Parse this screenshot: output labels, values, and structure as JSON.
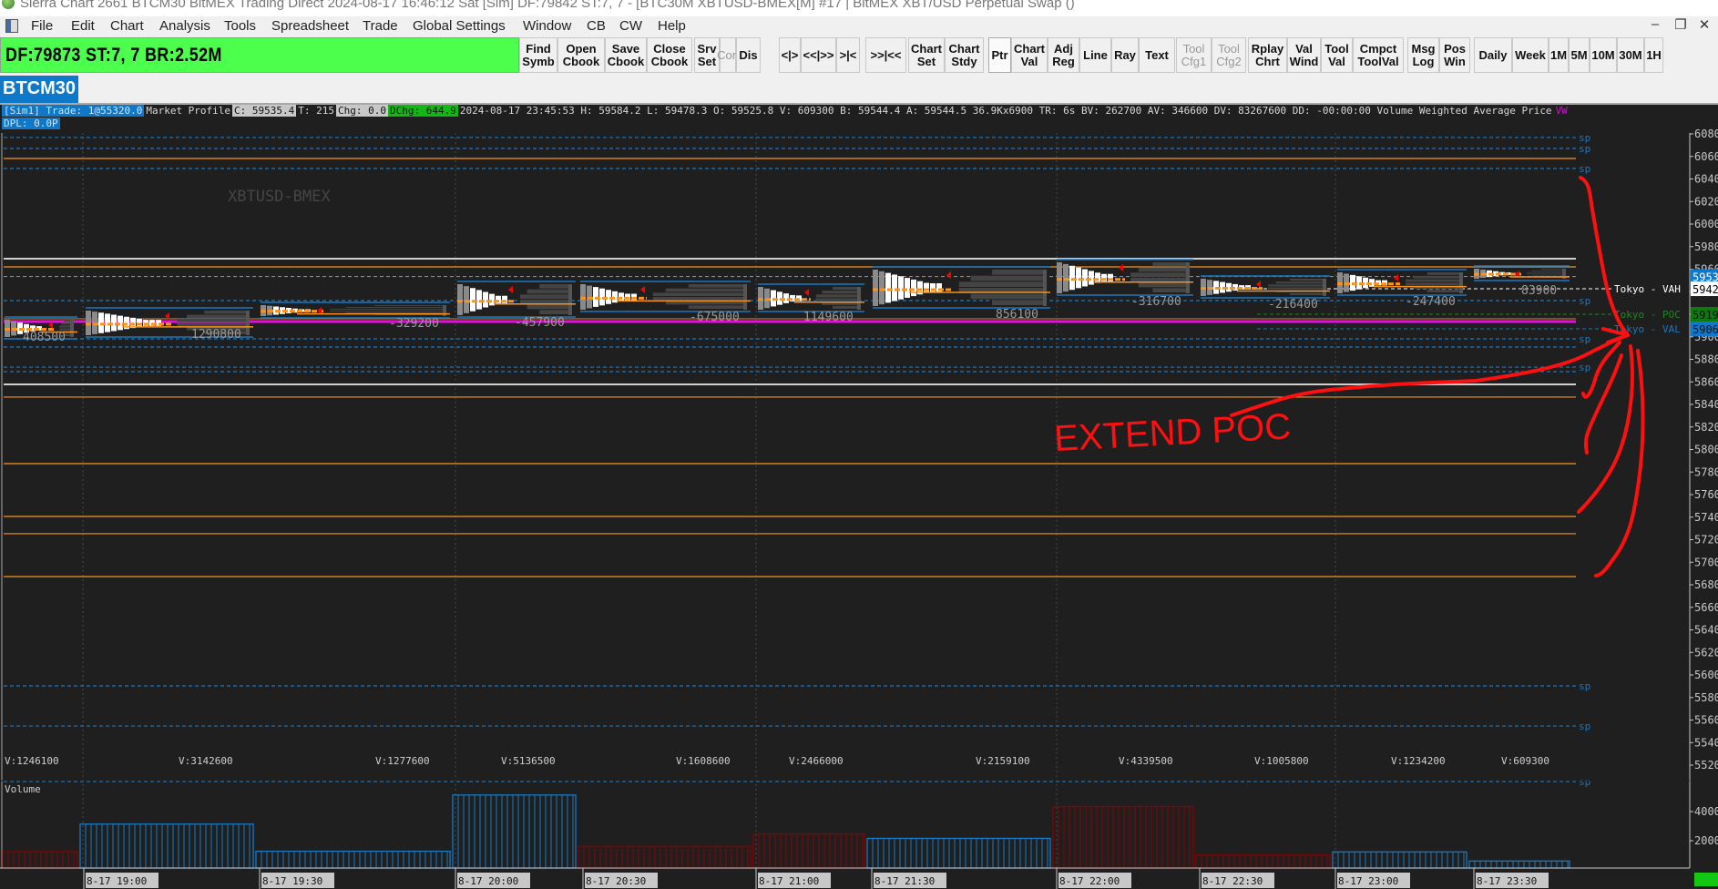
{
  "window": {
    "title": "Sierra Chart 2661 BTCM30 BitMEX Trading Direct 2024-08-17  16:46:12 Sat [Sim] DF:79842  ST:7, 7 - [BTC30M XBTUSD-BMEX[M] #17 | BitMEX XBT/USD Perpetual Swap ()",
    "controls": {
      "minimize": "–",
      "restore": "❐",
      "close": "✕"
    }
  },
  "menu": [
    "File",
    "Edit",
    "Chart",
    "Analysis",
    "Tools",
    "Spreadsheet",
    "Trade",
    "Global Settings",
    "Window",
    "CB",
    "CW",
    "Help"
  ],
  "status_box": {
    "text": "DF:79873  ST:7, 7  BR:2.52M",
    "color": "#4cff4c"
  },
  "toolbar": [
    {
      "label": "Find\nSymb"
    },
    {
      "label": "Open\nCbook"
    },
    {
      "label": "Save\nCbook"
    },
    {
      "label": "Close\nCbook"
    },
    {
      "label": "Srv\nSet"
    },
    {
      "label": "Con",
      "disabled": true
    },
    {
      "label": "Dis"
    },
    {
      "label": "<|>"
    },
    {
      "label": "<<|>>"
    },
    {
      "label": ">|<"
    },
    {
      "label": ">>|<<"
    },
    {
      "label": "Chart\nSet"
    },
    {
      "label": "Chart\nStdy"
    },
    {
      "label": "Ptr",
      "selected": true
    },
    {
      "label": "Chart\nVal"
    },
    {
      "label": "Adj\nReg"
    },
    {
      "label": "Line"
    },
    {
      "label": "Ray"
    },
    {
      "label": "Text"
    },
    {
      "label": "Tool\nCfg1",
      "disabled": true
    },
    {
      "label": "Tool\nCfg2",
      "disabled": true
    },
    {
      "label": "Rplay\nChrt"
    },
    {
      "label": "Val\nWind"
    },
    {
      "label": "Tool\nVal"
    },
    {
      "label": "Cmpct\nToolVal"
    },
    {
      "label": "Msg\nLog"
    },
    {
      "label": "Pos\nWin"
    },
    {
      "label": "Daily"
    },
    {
      "label": "Week"
    },
    {
      "label": "1M"
    },
    {
      "label": "5M"
    },
    {
      "label": "10M"
    },
    {
      "label": "30M"
    },
    {
      "label": "1H"
    }
  ],
  "chart_tab": {
    "label": "BTCM30",
    "color": "#0f78c8"
  },
  "info_bar": {
    "sim_trade": "[Sim1]  Trade: 1@55320.0",
    "study": "Market Profile",
    "close": "C: 59535.4",
    "ticks": "T: 215",
    "chg": "Chg: 0.0",
    "dchg": "DChg: 644.9",
    "details": "2024-08-17 23:45:53 H: 59584.2 L: 59478.3 O: 59525.8 V: 609300 B: 59544.4 A: 59544.5 36.9Kx6900 TR: 6s BV: 262700 AV: 346600 DV: 83267600 DD: -00:00:00 Volume Weighted Average Price",
    "vwap_tag": "VW",
    "dpl": "DPL: 0.0P"
  },
  "symbol_watermark": "XBTUSD-BMEX",
  "chart_data": {
    "type": "market-profile",
    "price_axis": {
      "ticks": [
        60800,
        60600,
        60400,
        60200,
        60000,
        59800,
        59600,
        59400,
        59200,
        59000,
        58800,
        58600,
        58400,
        58200,
        58000,
        57800,
        57600,
        57400,
        57200,
        57000,
        56800,
        56600,
        56400,
        56200,
        56000,
        55800,
        55600,
        55400,
        55200
      ]
    },
    "price_labels": [
      {
        "text": "5953",
        "price": 59535.4,
        "bg": "#0f78c8",
        "fg": "#ffffff"
      },
      {
        "text": "5942",
        "price": 59426,
        "bg": "#ffffff",
        "fg": "#000000"
      },
      {
        "text": "5919",
        "price": 59200,
        "bg": "#0e7a0e",
        "fg": "#111111"
      },
      {
        "text": "5906",
        "price": 59071,
        "bg": "#0f78c8",
        "fg": "#111111"
      }
    ],
    "session_levels": [
      {
        "text": "Tokyo  -  VAH",
        "price": 59426,
        "color": "#ffffff"
      },
      {
        "text": "Tokyo  -  POC",
        "price": 59200,
        "color": "#1a8a1a"
      },
      {
        "text": "Tokyo  -  VAL",
        "price": 59071,
        "color": "#1a78c0"
      }
    ],
    "levels": [
      {
        "price": 60768,
        "style": "dashed",
        "color": "#1a78c0",
        "tag": "sp"
      },
      {
        "price": 60671,
        "style": "dashed",
        "color": "#1a78c0",
        "tag": "sp"
      },
      {
        "price": 60582,
        "style": "solid",
        "color": "#f7931e"
      },
      {
        "price": 60493,
        "style": "dashed",
        "color": "#1a78c0",
        "tag": "sp"
      },
      {
        "price": 59693,
        "style": "solid",
        "color": "#d0d0d0"
      },
      {
        "price": 59620,
        "style": "solid",
        "color": "#f7931e"
      },
      {
        "price": 59535,
        "style": "dashed",
        "color": "#8a8a8a"
      },
      {
        "price": 59321,
        "style": "dashed",
        "color": "#1a78c0",
        "tag": "sp"
      },
      {
        "price": 59160,
        "style": "solid",
        "color": "#c87020"
      },
      {
        "price": 59135,
        "style": "solid",
        "color": "#e010e0"
      },
      {
        "price": 58982,
        "style": "dashed",
        "color": "#1a78c0",
        "tag": "sp"
      },
      {
        "price": 58909,
        "style": "dashed",
        "color": "#1a78c0"
      },
      {
        "price": 58731,
        "style": "dashed",
        "color": "#1a78c0",
        "tag": "sp"
      },
      {
        "price": 58691,
        "style": "dashed",
        "color": "#1a78c0"
      },
      {
        "price": 58578,
        "style": "solid",
        "color": "#d0d0d0"
      },
      {
        "price": 58465,
        "style": "solid",
        "color": "#f7931e"
      },
      {
        "price": 57875,
        "style": "solid",
        "color": "#f7931e"
      },
      {
        "price": 57406,
        "style": "solid",
        "color": "#f7931e"
      },
      {
        "price": 57253,
        "style": "solid",
        "color": "#f7931e"
      },
      {
        "price": 56873,
        "style": "solid",
        "color": "#f7931e"
      },
      {
        "price": 55903,
        "style": "dashed",
        "color": "#1a78c0",
        "tag": "sp"
      },
      {
        "price": 55547,
        "style": "dashed",
        "color": "#1a78c0",
        "tag": "sp"
      },
      {
        "price": 55054,
        "style": "dashed",
        "color": "#1a78c0",
        "tag": "sp"
      }
    ],
    "delta_labels": [
      "408500",
      "1290800",
      "-329200",
      "-457900",
      "-675000",
      "1149600",
      "856100",
      "-316700",
      "-216400",
      "-247400",
      "83900"
    ],
    "period_volumes": [
      "V:1246100",
      "V:3142600",
      "V:1277600",
      "V:5136500",
      "V:1608600",
      "V:2466000",
      "V:2159100",
      "V:4339500",
      "V:1005800",
      "V:1234200",
      "V:609300"
    ],
    "volume_pane": {
      "title": "Volume",
      "ticks": [
        4000,
        2000
      ],
      "values": [
        1246.1,
        3142.6,
        1277.6,
        5136.5,
        1608.6,
        2466.0,
        2159.1,
        4339.5,
        1005.8,
        1234.2,
        609.3
      ],
      "colors": [
        "#8b0000",
        "#1a78c0",
        "#1a78c0",
        "#1a78c0",
        "#8b0000",
        "#8b0000",
        "#1a78c0",
        "#8b0000",
        "#8b0000",
        "#1a78c0",
        "#1a78c0"
      ]
    },
    "time_axis": [
      "8-17  19:00",
      "8-17  19:30",
      "8-17  20:00",
      "8-17  20:30",
      "8-17  21:00",
      "8-17  21:30",
      "8-17  22:00",
      "8-17  22:30",
      "8-17  23:00",
      "8-17  23:30"
    ]
  },
  "annotation": {
    "text": "EXTEND POC",
    "color": "#ff0000"
  }
}
